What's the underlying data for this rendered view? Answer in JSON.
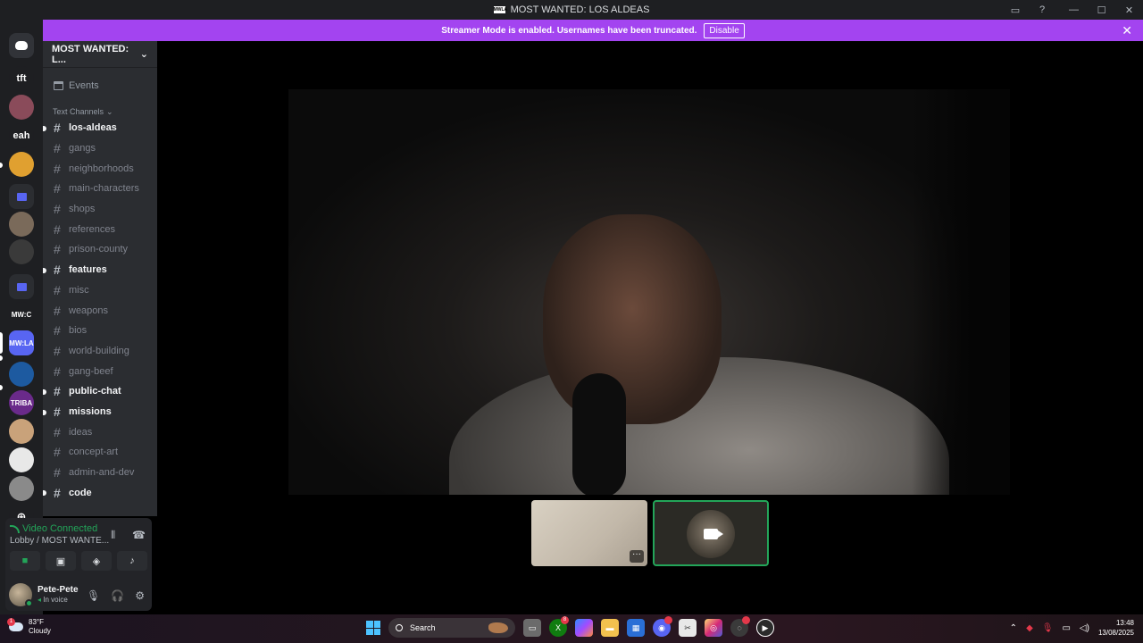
{
  "window": {
    "title": "MOST WANTED: LOS ALDEAS",
    "logo_text": "MWLA"
  },
  "banner": {
    "text": "Streamer Mode is enabled. Usernames have been truncated.",
    "button": "Disable"
  },
  "guilds": [
    {
      "label": "",
      "kind": "discord-home",
      "color": "#313338"
    },
    {
      "label": "tft",
      "kind": "text",
      "color": "#1e1f22"
    },
    {
      "label": "",
      "kind": "image",
      "color": "#8a4b5a"
    },
    {
      "label": "eah",
      "kind": "text",
      "color": "#1e1f22"
    },
    {
      "label": "",
      "kind": "image",
      "color": "#e0a030"
    },
    {
      "label": "",
      "kind": "folder",
      "color": "#5865f2"
    },
    {
      "label": "",
      "kind": "image",
      "color": "#7a6a5a"
    },
    {
      "label": "",
      "kind": "image",
      "color": "#3a3a3a"
    },
    {
      "label": "",
      "kind": "folder",
      "color": "#5865f2"
    },
    {
      "label": "MW:C",
      "kind": "text",
      "color": "#1e1f22"
    },
    {
      "label": "MW:LA",
      "kind": "selected",
      "color": "#5865f2"
    },
    {
      "label": "",
      "kind": "image",
      "color": "#1d5aa0"
    },
    {
      "label": "TRIBA",
      "kind": "image",
      "color": "#6a2a8a"
    },
    {
      "label": "",
      "kind": "image",
      "color": "#c9a27a"
    },
    {
      "label": "",
      "kind": "image",
      "color": "#e8e8e8"
    },
    {
      "label": "",
      "kind": "image",
      "color": "#8a8a8a"
    },
    {
      "label": "",
      "kind": "add",
      "color": "#1e1f22"
    }
  ],
  "sidebar": {
    "server_name": "MOST WANTED: L...",
    "events_label": "Events",
    "category": "Text Channels",
    "channels": [
      {
        "name": "los-aldeas",
        "unread": true
      },
      {
        "name": "gangs",
        "unread": false
      },
      {
        "name": "neighborhoods",
        "unread": false
      },
      {
        "name": "main-characters",
        "unread": false
      },
      {
        "name": "shops",
        "unread": false
      },
      {
        "name": "references",
        "unread": false
      },
      {
        "name": "prison-county",
        "unread": false
      },
      {
        "name": "features",
        "unread": true
      },
      {
        "name": "misc",
        "unread": false
      },
      {
        "name": "weapons",
        "unread": false
      },
      {
        "name": "bios",
        "unread": false
      },
      {
        "name": "world-building",
        "unread": false
      },
      {
        "name": "gang-beef",
        "unread": false
      },
      {
        "name": "public-chat",
        "unread": true
      },
      {
        "name": "missions",
        "unread": true
      },
      {
        "name": "ideas",
        "unread": false
      },
      {
        "name": "concept-art",
        "unread": false
      },
      {
        "name": "admin-and-dev",
        "unread": false
      },
      {
        "name": "code",
        "unread": true
      }
    ]
  },
  "voice": {
    "status": "Video Connected",
    "location": "Lobby / MOST WANTE..."
  },
  "user": {
    "name": "Pete-Pete",
    "status": "In voice"
  },
  "taskbar": {
    "weather_temp": "83°F",
    "weather_desc": "Cloudy",
    "weather_badge": "1",
    "search_label": "Search",
    "xbox_badge": "8",
    "time": "13:48",
    "date": "13/08/2025"
  },
  "colors": {
    "banner": "#a344f0",
    "connected": "#23a559",
    "sidebar": "#2b2d31",
    "rail": "#1e1f22"
  }
}
